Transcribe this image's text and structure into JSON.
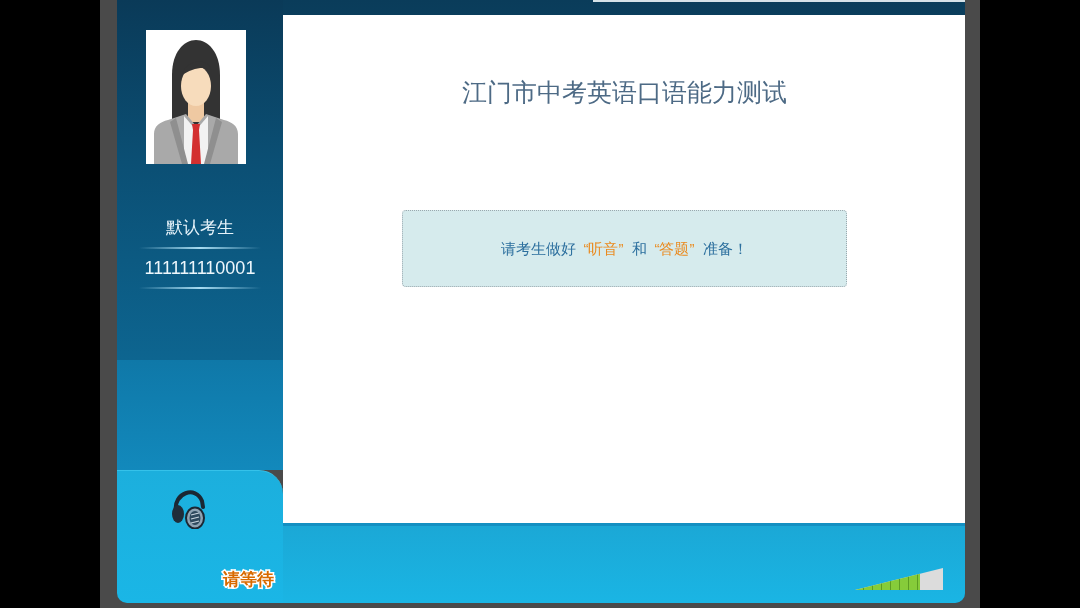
{
  "candidate": {
    "name": "默认考生",
    "id": "111111110001"
  },
  "header": {
    "title": "江门市中考英语口语能力测试"
  },
  "notice": {
    "parts": [
      {
        "text": "请考生做好",
        "highlight": false
      },
      {
        "text": "“听音”",
        "highlight": true
      },
      {
        "text": "和",
        "highlight": false
      },
      {
        "text": "“答题”",
        "highlight": true
      },
      {
        "text": "准备！",
        "highlight": false
      }
    ]
  },
  "status": {
    "text": "请等待"
  },
  "volume_meter": {
    "level": 0.74
  }
}
